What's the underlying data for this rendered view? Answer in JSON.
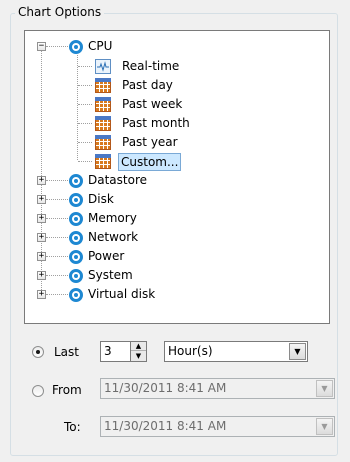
{
  "group": {
    "title": "Chart Options"
  },
  "tree": {
    "root": {
      "label": "CPU",
      "icon": "metric-icon",
      "expanded": true
    },
    "children": [
      {
        "label": "Real-time",
        "icon": "realtime-chart-icon"
      },
      {
        "label": "Past day",
        "icon": "calendar-icon"
      },
      {
        "label": "Past week",
        "icon": "calendar-icon"
      },
      {
        "label": "Past month",
        "icon": "calendar-icon"
      },
      {
        "label": "Past year",
        "icon": "calendar-icon"
      },
      {
        "label": "Custom...",
        "icon": "calendar-icon",
        "selected": true
      }
    ],
    "collapsed": [
      {
        "label": "Datastore",
        "icon": "metric-icon"
      },
      {
        "label": "Disk",
        "icon": "metric-icon"
      },
      {
        "label": "Memory",
        "icon": "metric-icon"
      },
      {
        "label": "Network",
        "icon": "metric-icon"
      },
      {
        "label": "Power",
        "icon": "metric-icon"
      },
      {
        "label": "System",
        "icon": "metric-icon"
      },
      {
        "label": "Virtual disk",
        "icon": "metric-icon"
      }
    ]
  },
  "range": {
    "last": {
      "label": "Last",
      "checked": true,
      "count": "3",
      "unit": "Hour(s)"
    },
    "from": {
      "label": "From",
      "checked": false,
      "value": "11/30/2011  8:41 AM"
    },
    "to": {
      "label": "To:",
      "value": "11/30/2011  8:41 AM"
    }
  },
  "colors": {
    "accent": "#1e88d2",
    "selection": "#cce8ff",
    "calendar": "#d87a1e",
    "background": "#f0f0f0"
  }
}
